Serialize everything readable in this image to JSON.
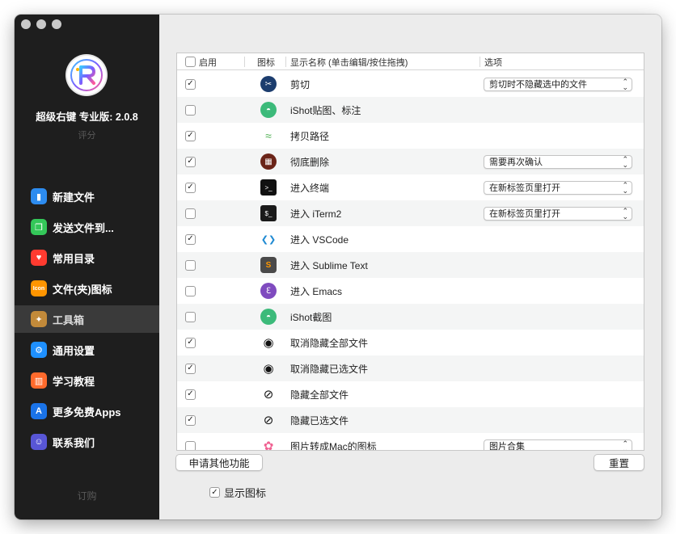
{
  "sidebar": {
    "app_name": "超级右键 专业版: 2.0.8",
    "rate": "评分",
    "buy": "订购",
    "items": [
      {
        "label": "新建文件",
        "icon": "new-file-icon",
        "color": "#2d8cf0",
        "glyph": "▮",
        "active": false
      },
      {
        "label": "发送文件到...",
        "icon": "send-file-icon",
        "color": "#34c759",
        "glyph": "❐",
        "active": false
      },
      {
        "label": "常用目录",
        "icon": "heart-icon",
        "color": "#ff3b30",
        "glyph": "♥",
        "active": false
      },
      {
        "label": "文件(夹)图标",
        "icon": "icon-badge-icon",
        "color": "#ff9500",
        "glyph": "Icon",
        "active": false
      },
      {
        "label": "工具箱",
        "icon": "toolbox-icon",
        "color": "#c28a3a",
        "glyph": "✦",
        "active": true
      },
      {
        "label": "通用设置",
        "icon": "gear-icon",
        "color": "#1e90ff",
        "glyph": "⚙",
        "active": false
      },
      {
        "label": "学习教程",
        "icon": "book-icon",
        "color": "#ff6a2c",
        "glyph": "▥",
        "active": false
      },
      {
        "label": "更多免费Apps",
        "icon": "app-store-icon",
        "color": "#1a73e8",
        "glyph": "A",
        "active": false
      },
      {
        "label": "联系我们",
        "icon": "contacts-icon",
        "color": "#5856d6",
        "glyph": "☺",
        "active": false
      }
    ]
  },
  "table": {
    "headers": {
      "enabled": "启用",
      "icon": "图标",
      "name": "显示名称 (单击编辑/按住拖拽)",
      "options": "选项"
    },
    "rows": [
      {
        "checked": true,
        "name": "剪切",
        "icon": "scissors-icon",
        "color": "#1c3d6e",
        "glyph": "✂",
        "option": "剪切时不隐藏选中的文件"
      },
      {
        "checked": false,
        "name": "iShot贴图、标注",
        "icon": "ishot-icon",
        "color": "#3cba7a",
        "glyph": "◓",
        "option": ""
      },
      {
        "checked": true,
        "name": "拷贝路径",
        "icon": "copy-path-icon",
        "color": "#9ed36a",
        "glyph": "≈",
        "option": ""
      },
      {
        "checked": true,
        "name": "彻底删除",
        "icon": "trash-icon",
        "color": "#6b2418",
        "glyph": "▦",
        "option": "需要再次确认"
      },
      {
        "checked": true,
        "name": "进入终端",
        "icon": "terminal-icon",
        "color": "#111111",
        "glyph": ">_",
        "option": "在新标签页里打开"
      },
      {
        "checked": false,
        "name": "进入 iTerm2",
        "icon": "iterm-icon",
        "color": "#1a1a1a",
        "glyph": "$_",
        "option": "在新标签页里打开"
      },
      {
        "checked": true,
        "name": "进入 VSCode",
        "icon": "vscode-icon",
        "color": "#1f8ad2",
        "glyph": "❮❯",
        "option": ""
      },
      {
        "checked": false,
        "name": "进入 Sublime Text",
        "icon": "sublime-icon",
        "color": "#ff8f1f",
        "glyph": "S",
        "option": ""
      },
      {
        "checked": false,
        "name": "进入 Emacs",
        "icon": "emacs-icon",
        "color": "#7f4bbf",
        "glyph": "ℇ",
        "option": ""
      },
      {
        "checked": false,
        "name": "iShot截图",
        "icon": "ishot-screenshot-icon",
        "color": "#3cba7a",
        "glyph": "◓",
        "option": ""
      },
      {
        "checked": true,
        "name": "取消隐藏全部文件",
        "icon": "eye-icon",
        "color": "#111111",
        "glyph": "◉",
        "option": ""
      },
      {
        "checked": true,
        "name": "取消隐藏已选文件",
        "icon": "eye-icon",
        "color": "#111111",
        "glyph": "◉",
        "option": ""
      },
      {
        "checked": true,
        "name": "隐藏全部文件",
        "icon": "eye-slash-icon",
        "color": "#111111",
        "glyph": "⊘",
        "option": ""
      },
      {
        "checked": true,
        "name": "隐藏已选文件",
        "icon": "eye-slash-icon",
        "color": "#111111",
        "glyph": "⊘",
        "option": ""
      },
      {
        "checked": false,
        "name": "图片转成Mac的图标",
        "icon": "photos-icon",
        "color": "#f5a623",
        "glyph": "✿",
        "option": "图片合集"
      }
    ]
  },
  "buttons": {
    "request": "申请其他功能",
    "reset": "重置"
  },
  "show_icon": {
    "label": "显示图标",
    "checked": true
  }
}
